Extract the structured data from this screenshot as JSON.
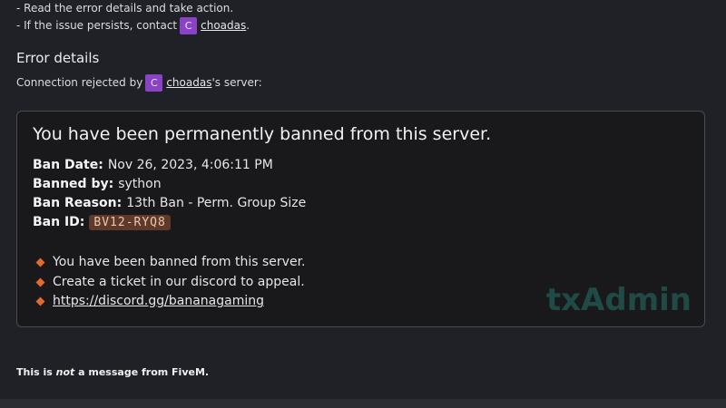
{
  "instructions": {
    "line1": "- Read the error details and take action.",
    "line2_prefix": "- If the issue persists, contact",
    "line2_suffix": "."
  },
  "owner": {
    "avatar_letter": "C",
    "name": "choadas"
  },
  "error_details": {
    "heading": "Error details",
    "rejected_prefix": "Connection rejected by",
    "rejected_suffix": "'s server:"
  },
  "ban": {
    "title": "You have been permanently banned from this server.",
    "date_label": "Ban Date:",
    "date_value": "Nov 26, 2023, 4:06:11 PM",
    "by_label": "Banned by:",
    "by_value": "sython",
    "reason_label": "Ban Reason:",
    "reason_value": "13th Ban - Perm. Group Size",
    "id_label": "Ban ID:",
    "id_value": "BV12-RYQ8",
    "notes": [
      "You have been banned from this server.",
      "Create a ticket in our discord to appeal.",
      "https://discord.gg/bananagaming"
    ],
    "watermark": "txAdmin"
  },
  "footer": {
    "disclaimer_a": "This is ",
    "disclaimer_em": "not",
    "disclaimer_b": " a message from FiveM."
  },
  "colors": {
    "background": "#202126",
    "card": "#19191c",
    "avatar": "#8a43c4",
    "bullet": "#e26a2c",
    "ban_id_bg": "#5e3a2d",
    "watermark": "#1f4a45"
  }
}
